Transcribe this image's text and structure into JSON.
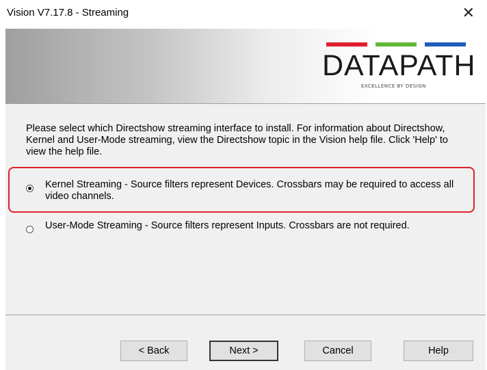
{
  "window": {
    "title": "Vision V7.17.8 - Streaming",
    "close_glyph": "✕"
  },
  "banner": {
    "logo_text": "DATAPATH",
    "tagline": "EXCELLENCE BY DESIGN",
    "stripe_colors": [
      "#e01e2e",
      "#62b83a",
      "#1f5db8"
    ]
  },
  "content": {
    "intro": "Please select which Directshow streaming interface to install.  For information about Directshow, Kernel and User-Mode streaming, view the Directshow topic in the Vision help file. Click 'Help' to view the help file.",
    "options": [
      {
        "label": "Kernel Streaming - Source filters represent Devices. Crossbars may be required to access all video channels.",
        "checked": true
      },
      {
        "label": "User-Mode Streaming - Source filters represent Inputs. Crossbars are not required.",
        "checked": false
      }
    ]
  },
  "buttons": {
    "back": "< Back",
    "next": "Next >",
    "cancel": "Cancel",
    "help": "Help"
  },
  "highlight_color": "#e0202a"
}
